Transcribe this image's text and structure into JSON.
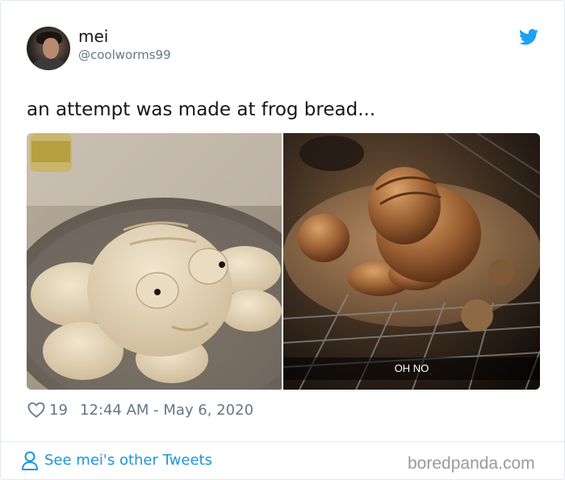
{
  "tweet": {
    "author_name": "mei",
    "author_handle": "@coolworms99",
    "text": "an attempt was made at frog bread...",
    "like_count": "19",
    "timestamp": "12:44 AM - May 6, 2020"
  },
  "media": {
    "right_photo_caption": "OH NO"
  },
  "footer": {
    "see_more_label": "See mei's other Tweets",
    "watermark": "boredpanda.com"
  },
  "icons": {
    "brand": "twitter-bird-icon",
    "like": "heart-icon",
    "profile": "person-icon"
  },
  "colors": {
    "twitter_blue": "#1da1f2",
    "link_blue": "#1b95e0",
    "muted_text": "#657786"
  }
}
